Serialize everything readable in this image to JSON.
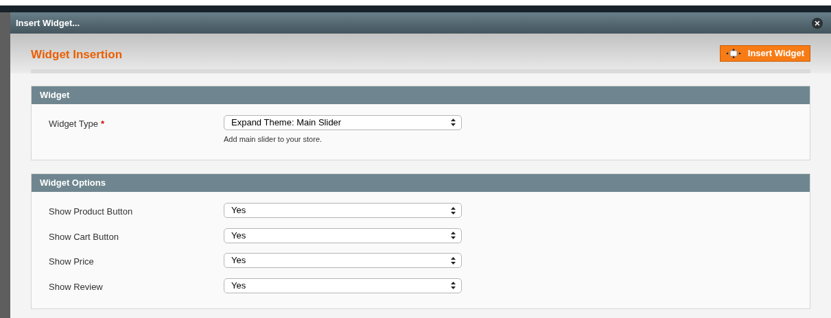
{
  "window": {
    "title": "Insert Widget..."
  },
  "header": {
    "title": "Widget Insertion",
    "button": "Insert Widget"
  },
  "sections": [
    {
      "title": "Widget",
      "fields": [
        {
          "label": "Widget Type",
          "required_mark": "*",
          "value": "Expand Theme: Main Slider",
          "note": "Add main slider to your store."
        }
      ]
    },
    {
      "title": "Widget Options",
      "fields": [
        {
          "label": "Show Product Button",
          "value": "Yes"
        },
        {
          "label": "Show Cart Button",
          "value": "Yes"
        },
        {
          "label": "Show Price",
          "value": "Yes"
        },
        {
          "label": "Show Review",
          "value": "Yes"
        }
      ]
    }
  ]
}
